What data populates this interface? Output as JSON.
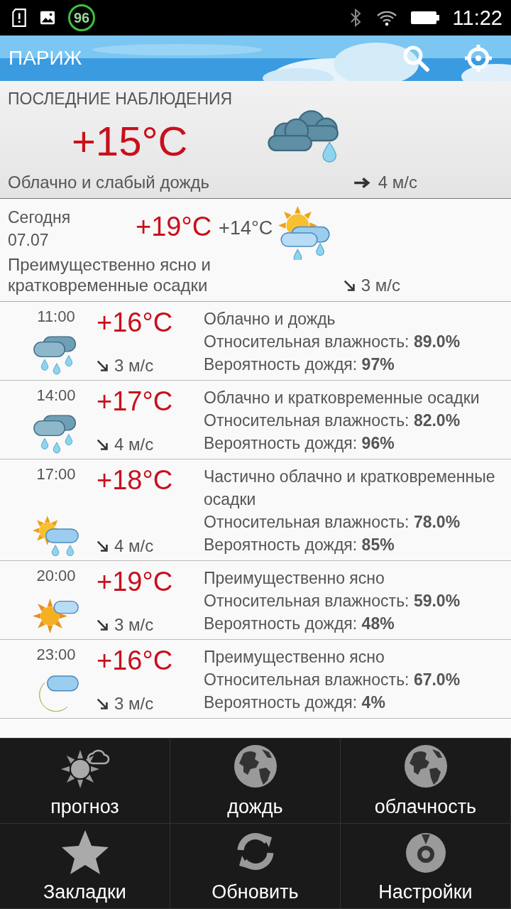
{
  "status_bar": {
    "battery_badge": "96",
    "time": "11:22"
  },
  "app_bar": {
    "title": "ПАРИЖ"
  },
  "observation": {
    "heading": "ПОСЛЕДНИЕ НАБЛЮДЕНИЯ",
    "temperature": "+15°C",
    "kind": "rain",
    "condition": "Облачно и слабый дождь",
    "wind": {
      "kind": "east",
      "speed": "4 м/с"
    }
  },
  "today": {
    "day": "Сегодня",
    "date": "07.07",
    "high": "+19°C",
    "low": "+14°C",
    "kind": "sun_cloud_rain",
    "condition": "Преимущественно ясно и кратковременные осадки",
    "wind": {
      "kind": "southeast",
      "speed": "3 м/с"
    }
  },
  "hours": [
    {
      "time": "11:00",
      "temperature": "+16°C",
      "kind": "rain",
      "wind": {
        "kind": "southeast",
        "speed": "3 м/с"
      },
      "condition": "Облачно и дождь",
      "humidity": "Относительная влажность: **89.0%**",
      "rain_chance": "Вероятность дождя: **97%**"
    },
    {
      "time": "14:00",
      "temperature": "+17°C",
      "kind": "rain",
      "wind": {
        "kind": "southeast",
        "speed": "4 м/с"
      },
      "condition": "Облачно и кратковременные осадки",
      "humidity": "Относительная влажность: **82.0%**",
      "rain_chance": "Вероятность дождя: **96%**"
    },
    {
      "time": "17:00",
      "temperature": "+18°C",
      "kind": "sun_cloud_rain",
      "wind": {
        "kind": "southeast",
        "speed": "4 м/с"
      },
      "condition": "Частично облачно и кратковременные осадки",
      "humidity": "Относительная влажность: **78.0%**",
      "rain_chance": "Вероятность дождя: **85%**"
    },
    {
      "time": "20:00",
      "temperature": "+19°C",
      "kind": "sun_cloud",
      "wind": {
        "kind": "southeast",
        "speed": "3 м/с"
      },
      "condition": "Преимущественно ясно",
      "humidity": "Относительная влажность: **59.0%**",
      "rain_chance": "Вероятность дождя: **48%**"
    },
    {
      "time": "23:00",
      "temperature": "+16°C",
      "kind": "moon_cloud",
      "wind": {
        "kind": "southeast",
        "speed": "3 м/с"
      },
      "condition": "Преимущественно ясно",
      "humidity": "Относительная влажность: **67.0%**",
      "rain_chance": "Вероятность дождя: **4%**"
    }
  ],
  "menu": [
    {
      "label": "прогноз",
      "kind": "sun_cloud"
    },
    {
      "label": "дождь",
      "kind": "globe"
    },
    {
      "label": "облачность",
      "kind": "globe"
    },
    {
      "label": "Закладки",
      "kind": "star"
    },
    {
      "label": "Обновить",
      "kind": "refresh"
    },
    {
      "label": "Настройки",
      "kind": "gear"
    }
  ]
}
